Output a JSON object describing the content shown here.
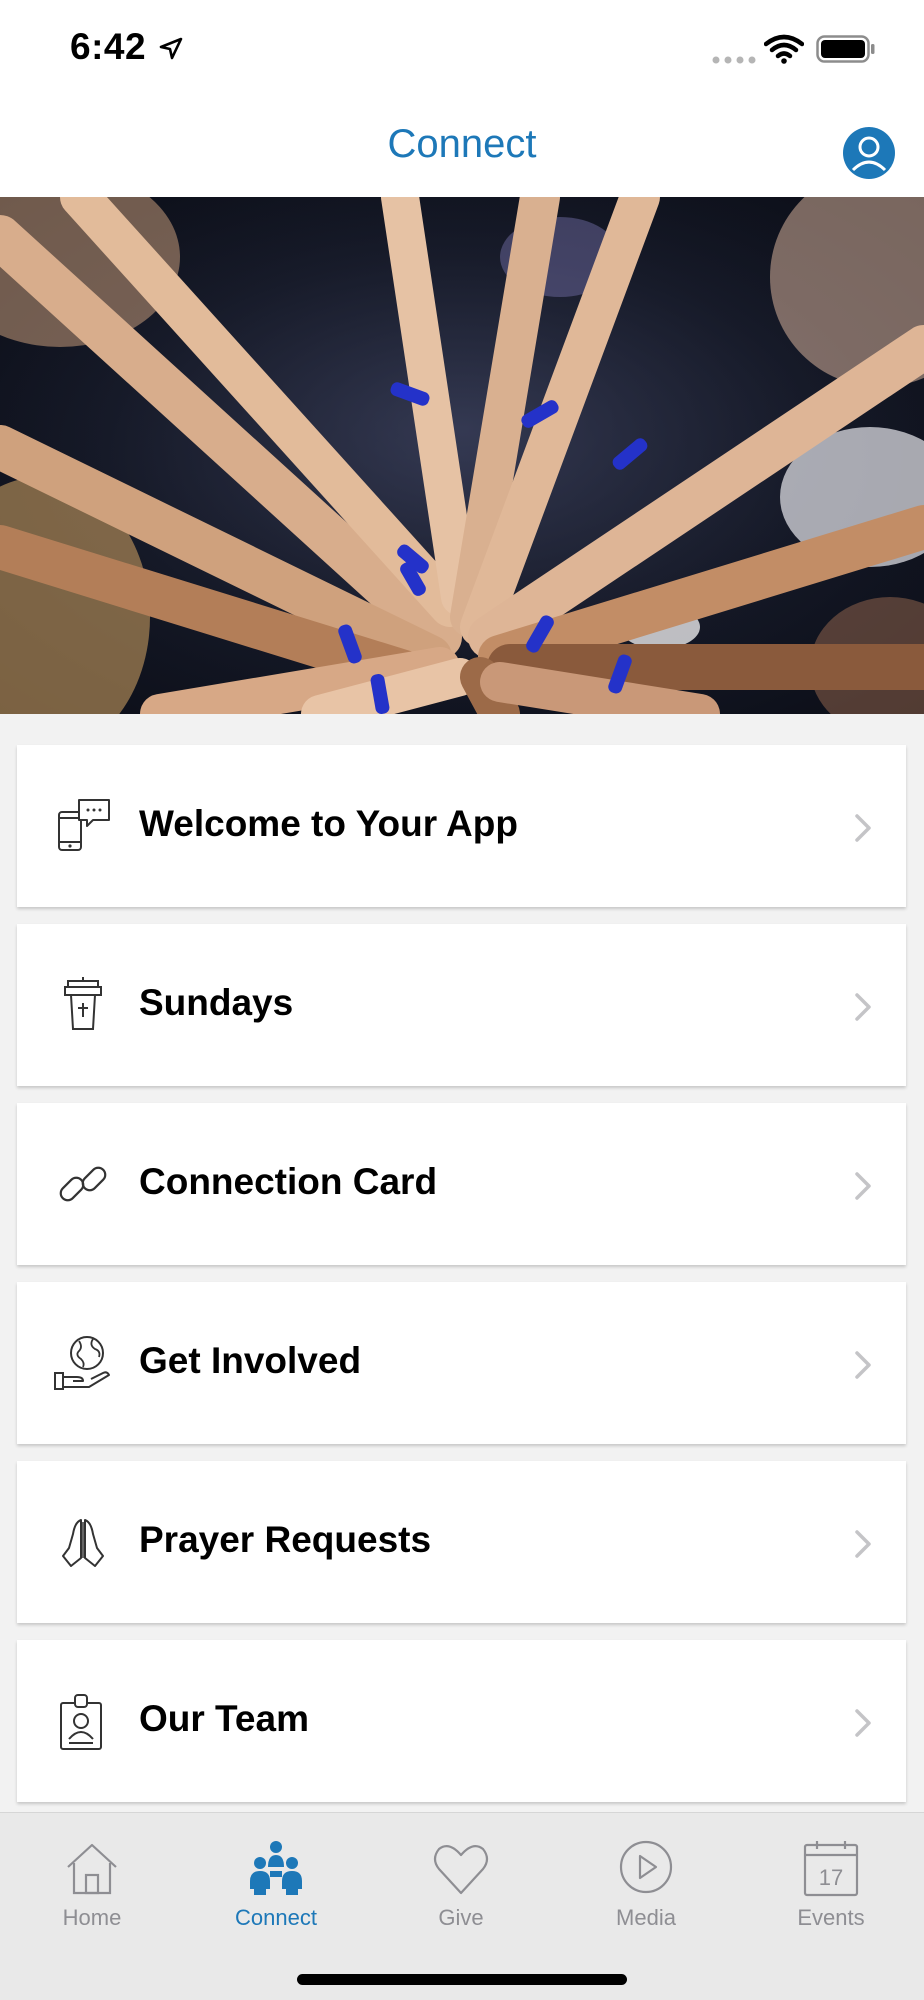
{
  "status_bar": {
    "time": "6:42"
  },
  "nav": {
    "title": "Connect",
    "accent": "#1d78b8"
  },
  "hero": {
    "image": "hands-together-photo"
  },
  "menu": [
    {
      "label": "Welcome to Your App",
      "icon": "phone-chat-icon"
    },
    {
      "label": "Sundays",
      "icon": "pulpit-icon"
    },
    {
      "label": "Connection Card",
      "icon": "link-icon"
    },
    {
      "label": "Get Involved",
      "icon": "globe-hand-icon"
    },
    {
      "label": "Prayer Requests",
      "icon": "praying-hands-icon"
    },
    {
      "label": "Our Team",
      "icon": "id-badge-icon"
    }
  ],
  "tabs": [
    {
      "label": "Home",
      "icon": "home-icon",
      "active": false
    },
    {
      "label": "Connect",
      "icon": "people-icon",
      "active": true
    },
    {
      "label": "Give",
      "icon": "heart-icon",
      "active": false
    },
    {
      "label": "Media",
      "icon": "play-icon",
      "active": false
    },
    {
      "label": "Events",
      "icon": "calendar-icon",
      "active": false,
      "date": "17"
    }
  ]
}
